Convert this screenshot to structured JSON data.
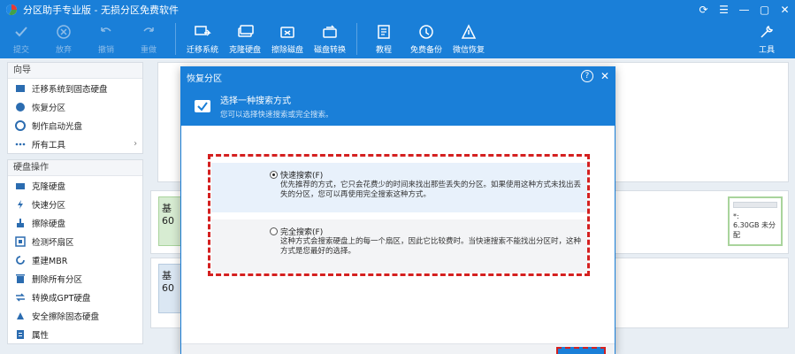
{
  "app": {
    "title": "分区助手专业版 - 无损分区免费软件"
  },
  "toolbar": {
    "items": [
      {
        "label": "提交",
        "icon": "check-icon",
        "enabled": false
      },
      {
        "label": "放弃",
        "icon": "cancel-icon",
        "enabled": false
      },
      {
        "label": "撤销",
        "icon": "undo-icon",
        "enabled": false
      },
      {
        "label": "重做",
        "icon": "redo-icon",
        "enabled": false
      },
      {
        "label": "迁移系统",
        "icon": "migrate-icon",
        "enabled": true
      },
      {
        "label": "克隆硬盘",
        "icon": "clone-disk-icon",
        "enabled": true
      },
      {
        "label": "擦除磁盘",
        "icon": "wipe-disk-icon",
        "enabled": true
      },
      {
        "label": "磁盘转换",
        "icon": "convert-disk-icon",
        "enabled": true
      },
      {
        "label": "教程",
        "icon": "tutorial-icon",
        "enabled": true
      },
      {
        "label": "免费备份",
        "icon": "backup-icon",
        "enabled": true
      },
      {
        "label": "微信恢复",
        "icon": "wechat-restore-icon",
        "enabled": true
      }
    ],
    "tools_label": "工具"
  },
  "sidebar": {
    "wizard_header": "向导",
    "wizard_items": [
      {
        "label": "迁移系统到固态硬盘",
        "icon": "migrate-ssd-icon"
      },
      {
        "label": "恢复分区",
        "icon": "recover-partition-icon"
      },
      {
        "label": "制作启动光盘",
        "icon": "boot-disc-icon"
      },
      {
        "label": "所有工具",
        "icon": "all-tools-icon"
      }
    ],
    "disk_header": "硬盘操作",
    "disk_items": [
      {
        "label": "克隆硬盘",
        "icon": "clone-icon"
      },
      {
        "label": "快速分区",
        "icon": "quick-partition-icon"
      },
      {
        "label": "擦除硬盘",
        "icon": "wipe-icon"
      },
      {
        "label": "检测坏扇区",
        "icon": "bad-sector-icon"
      },
      {
        "label": "重建MBR",
        "icon": "rebuild-mbr-icon"
      },
      {
        "label": "删除所有分区",
        "icon": "delete-all-icon"
      },
      {
        "label": "转换成GPT硬盘",
        "icon": "convert-gpt-icon"
      },
      {
        "label": "安全擦除固态硬盘",
        "icon": "secure-erase-icon"
      },
      {
        "label": "属性",
        "icon": "properties-icon"
      }
    ]
  },
  "background": {
    "disk1_label": "基",
    "disk1_size": "60",
    "disk2_label": "基",
    "disk2_size": "60",
    "right_partition_label": "*:",
    "right_partition_size": "6.30GB 未分配"
  },
  "dialog": {
    "title": "恢复分区",
    "help": "?",
    "close": "✕",
    "header_title": "选择一种搜索方式",
    "header_subtitle": "您可以选择快速搜索或完全搜索。",
    "option1_label": "快速搜索(F)",
    "option1_desc": "优先推荐的方式，它只会花费少的时间来找出那些丢失的分区。如果使用这种方式未找出丢失的分区，您可以再使用完全搜索这种方式。",
    "option2_label": "完全搜索(F)",
    "option2_desc": "这种方式会搜索硬盘上的每一个扇区，因此它比较费时。当快速搜索不能找出分区时，这种方式是您最好的选择。",
    "selected_option": 1
  },
  "colors": {
    "titlebar": "#1a7fd8",
    "highlight": "#d42020",
    "option_selected_bg": "#e8f1fb"
  }
}
